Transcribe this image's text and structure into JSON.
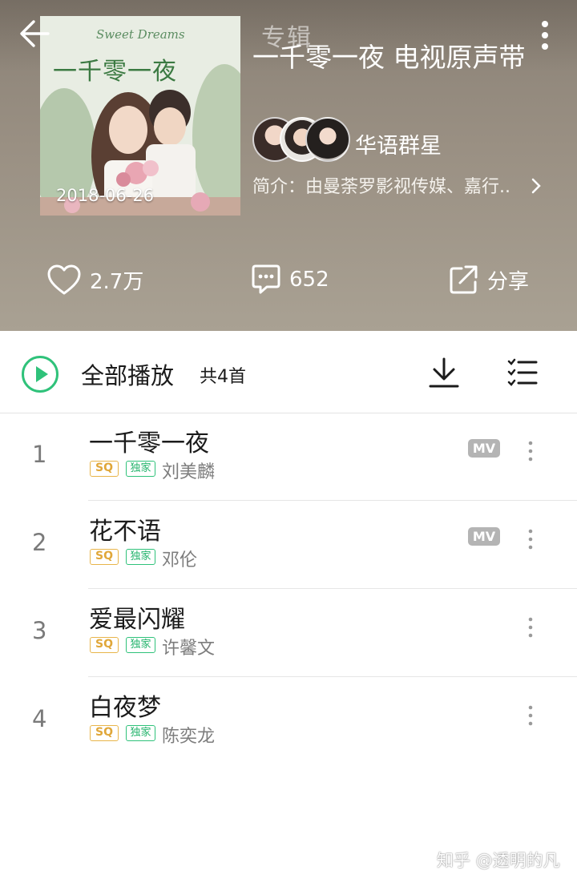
{
  "topbar": {
    "title": "专辑"
  },
  "album": {
    "title": "一千零一夜 电视原声带",
    "cover_date": "2018-06-26",
    "cover_title": "一千零一夜",
    "cover_subtitle": "Sweet Dreams",
    "artist": "华语群星",
    "intro": "简介：由曼荼罗影视传媒、嘉行.."
  },
  "actions": {
    "like_count": "2.7万",
    "comment_count": "652",
    "share_label": "分享"
  },
  "playbar": {
    "play_all": "全部播放",
    "count": "共4首"
  },
  "tags": {
    "sq": "SQ",
    "exclusive": "独家",
    "mv": "MV"
  },
  "songs": [
    {
      "index": "1",
      "title": "一千零一夜",
      "singer": "刘美麟",
      "has_mv": true
    },
    {
      "index": "2",
      "title": "花不语",
      "singer": "邓伦",
      "has_mv": true
    },
    {
      "index": "3",
      "title": "爱最闪耀",
      "singer": "许馨文",
      "has_mv": false
    },
    {
      "index": "4",
      "title": "白夜梦",
      "singer": "陈奕龙",
      "has_mv": false
    }
  ],
  "watermark": "知乎 @透明的凡",
  "colors": {
    "accent_green": "#2fc27a",
    "sq_gold": "#e8b54a"
  }
}
